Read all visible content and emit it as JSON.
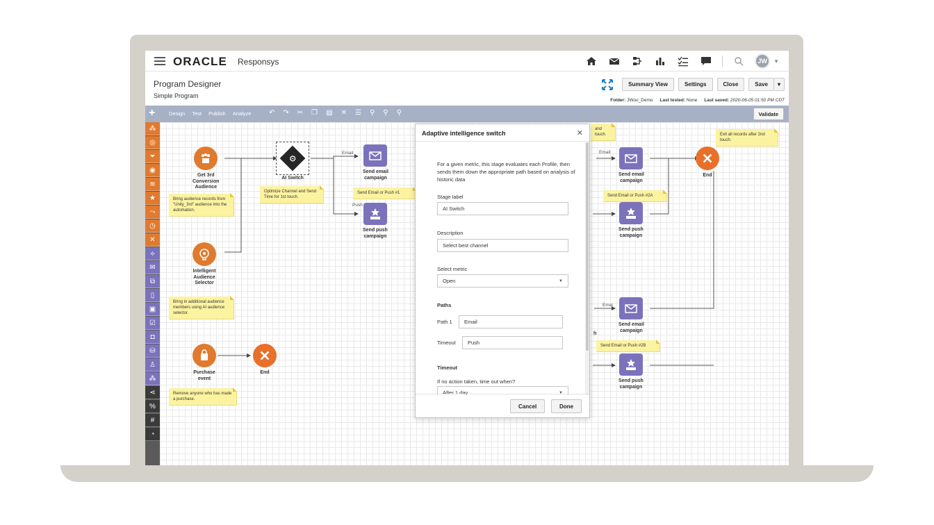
{
  "app": {
    "brand": "ORACLE",
    "product": "Responsys"
  },
  "topnav": {
    "icons": [
      "home-icon",
      "mail-icon",
      "workflow-icon",
      "chart-icon",
      "checklist-icon",
      "chat-icon",
      "search-icon"
    ],
    "avatar_initials": "JW"
  },
  "header": {
    "title": "Program Designer",
    "subtitle": "Simple Program",
    "buttons": {
      "summary": "Summary View",
      "settings": "Settings",
      "close": "Close",
      "save": "Save"
    },
    "meta": {
      "folder_label": "Folder:",
      "folder_value": "JWoo_Demo",
      "tested_label": "Last tested:",
      "tested_value": "None",
      "saved_label": "Last saved:",
      "saved_value": "2020-06-05 01:50 PM CDT"
    }
  },
  "toolbar": {
    "tabs": [
      "Design",
      "Test",
      "Publish",
      "Analyze"
    ],
    "active_tab": "Design",
    "validate": "Validate"
  },
  "canvas": {
    "nodes": {
      "get3rd": "Get 3rd\nConversion\nAudience",
      "aiswitch": "AI Switch",
      "intelligent": "Intelligent\nAudience\nSelector",
      "purchase": "Purchase\nevent",
      "end1": "End",
      "send_email_1": "Send email\ncampaign",
      "send_push_1": "Send push\ncampaign",
      "send_email_2a": "Send email\ncampaign",
      "send_push_2a": "Send push\ncampaign",
      "send_email_2b": "Send email\ncampaign",
      "send_push_2b": "Send push\ncampaign",
      "end2": "End",
      "partial_h": "h"
    },
    "notes": {
      "n1": "Bring audience records from \"Unity_3rd\" audience into the automation.",
      "n2": "Optimize Channel and Send Time for 1st touch.",
      "n3": "Send Email or Push #1",
      "n4": "Bring in additional audience members using AI audience selector.",
      "n5": "Remove anyone who has made a purchase.",
      "n6": "Send Email or Push #2A",
      "n7": "Send Email or Push #2B",
      "n8": "Exit all records after 2nd touch.",
      "n9": "and\ntouch."
    },
    "wire_labels": {
      "email1": "Email",
      "push1": "Push",
      "email2": "Email",
      "email3": "Emai"
    }
  },
  "dialog": {
    "title": "Adaptive intelligence switch",
    "description": "For a given metric, this stage evaluates each Profile, then sends them down the appropriate path based on analysis of historic data",
    "stage_label_label": "Stage label",
    "stage_label_value": "AI Switch",
    "description_label": "Description",
    "description_value": "Select best channel",
    "metric_label": "Select metric",
    "metric_value": "Open",
    "paths_heading": "Paths",
    "path1_label": "Path 1",
    "path1_value": "Email",
    "timeout_label": "Timeout",
    "timeout_value": "Push",
    "timeout_heading": "Timeout",
    "timeout_question": "If no action taken, time out when?",
    "timeout_select": "After 1 day",
    "cancel": "Cancel",
    "done": "Done"
  }
}
